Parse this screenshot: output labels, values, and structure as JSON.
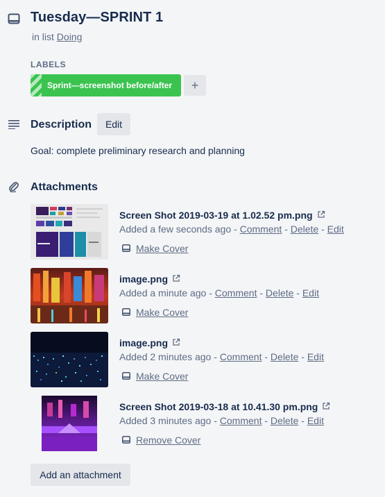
{
  "card": {
    "title": "Tuesday—SPRINT 1",
    "in_list_prefix": "in list",
    "list_name": "Doing"
  },
  "labels": {
    "heading": "LABELS",
    "items": [
      {
        "text": "Sprint—screenshot before/after",
        "color": "#3bc34f"
      }
    ],
    "add_symbol": "+"
  },
  "description": {
    "heading": "Description",
    "edit_label": "Edit",
    "text": "Goal: complete preliminary research and planning"
  },
  "attachments": {
    "heading": "Attachments",
    "separator": " - ",
    "items": [
      {
        "name": "Screen Shot 2019-03-19 at 1.02.52 pm.png",
        "added": "Added a few seconds ago",
        "comment": "Comment",
        "delete": "Delete",
        "edit": "Edit",
        "cover_action": "Make Cover"
      },
      {
        "name": "image.png",
        "added": "Added a minute ago",
        "comment": "Comment",
        "delete": "Delete",
        "edit": "Edit",
        "cover_action": "Make Cover"
      },
      {
        "name": "image.png",
        "added": "Added 2 minutes ago",
        "comment": "Comment",
        "delete": "Delete",
        "edit": "Edit",
        "cover_action": "Make Cover"
      },
      {
        "name": "Screen Shot 2019-03-18 at 10.41.30 pm.png",
        "added": "Added 3 minutes ago",
        "comment": "Comment",
        "delete": "Delete",
        "edit": "Edit",
        "cover_action": "Remove Cover"
      }
    ],
    "add_button": "Add an attachment"
  },
  "icons": {
    "card": "card-icon",
    "description": "description-lines-icon",
    "attachments": "paperclip-icon",
    "external": "external-link-icon",
    "cover": "cover-icon"
  },
  "colors": {
    "background": "#f4f5f7",
    "text": "#172b4d",
    "muted": "#5e6c84",
    "button": "#e4e6ea",
    "label_green": "#3bc34f"
  }
}
